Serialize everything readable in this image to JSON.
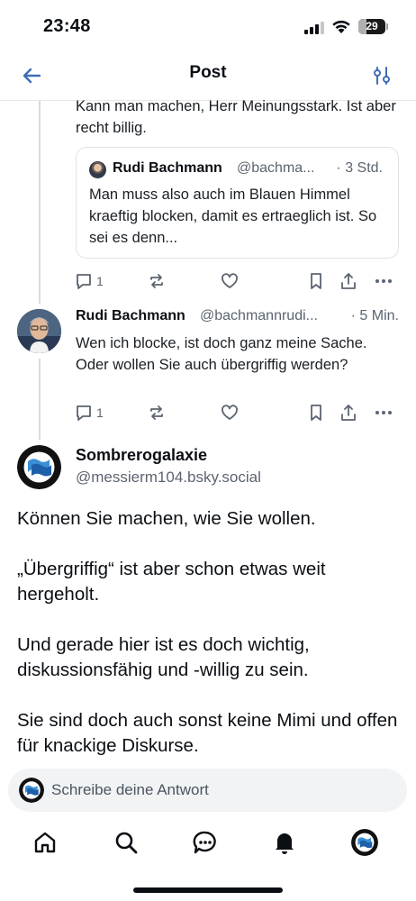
{
  "status_bar": {
    "time": "23:48",
    "battery": "29"
  },
  "header": {
    "title": "Post",
    "back_icon": "back-arrow-icon",
    "filter_icon": "sliders-icon"
  },
  "reply_partial": {
    "text": "Kann man machen, Herr Meinungsstark. Ist aber recht billig."
  },
  "quote": {
    "author": "Rudi Bachmann",
    "handle": "@bachma...",
    "time": "· 3 Std.",
    "text": "Man muss also auch im Blauen Himmel kraeftig blocken, damit es ertraeglich ist. So sei es denn..."
  },
  "actions_1": {
    "reply_count": "1"
  },
  "post2": {
    "author": "Rudi Bachmann",
    "handle": "@bachmannrudi...",
    "time": "· 5 Min.",
    "text": "Wen ich blocke, ist doch ganz meine Sache. Oder wollen Sie auch übergriffig werden?"
  },
  "actions_2": {
    "reply_count": "1"
  },
  "main_post": {
    "author": "Sombrerogalaxie",
    "handle": "@messierm104.bsky.social",
    "paragraphs": [
      "Können Sie machen, wie Sie wollen.",
      "„Übergriffig“ ist aber schon etwas weit hergeholt.",
      "Und gerade hier ist es doch wichtig, diskussionsfähig und -willig zu sein.",
      "Sie sind doch auch sonst keine Mimi und offen für knackige Diskurse."
    ]
  },
  "composer": {
    "placeholder": "Schreibe deine Antwort"
  },
  "tabbar": {
    "items": [
      "home-icon",
      "search-icon",
      "chat-icon",
      "bell-icon",
      "profile-avatar"
    ]
  },
  "colors": {
    "accent": "#0b0f14",
    "muted": "#5b6470",
    "link_blue": "#3f6db5"
  }
}
